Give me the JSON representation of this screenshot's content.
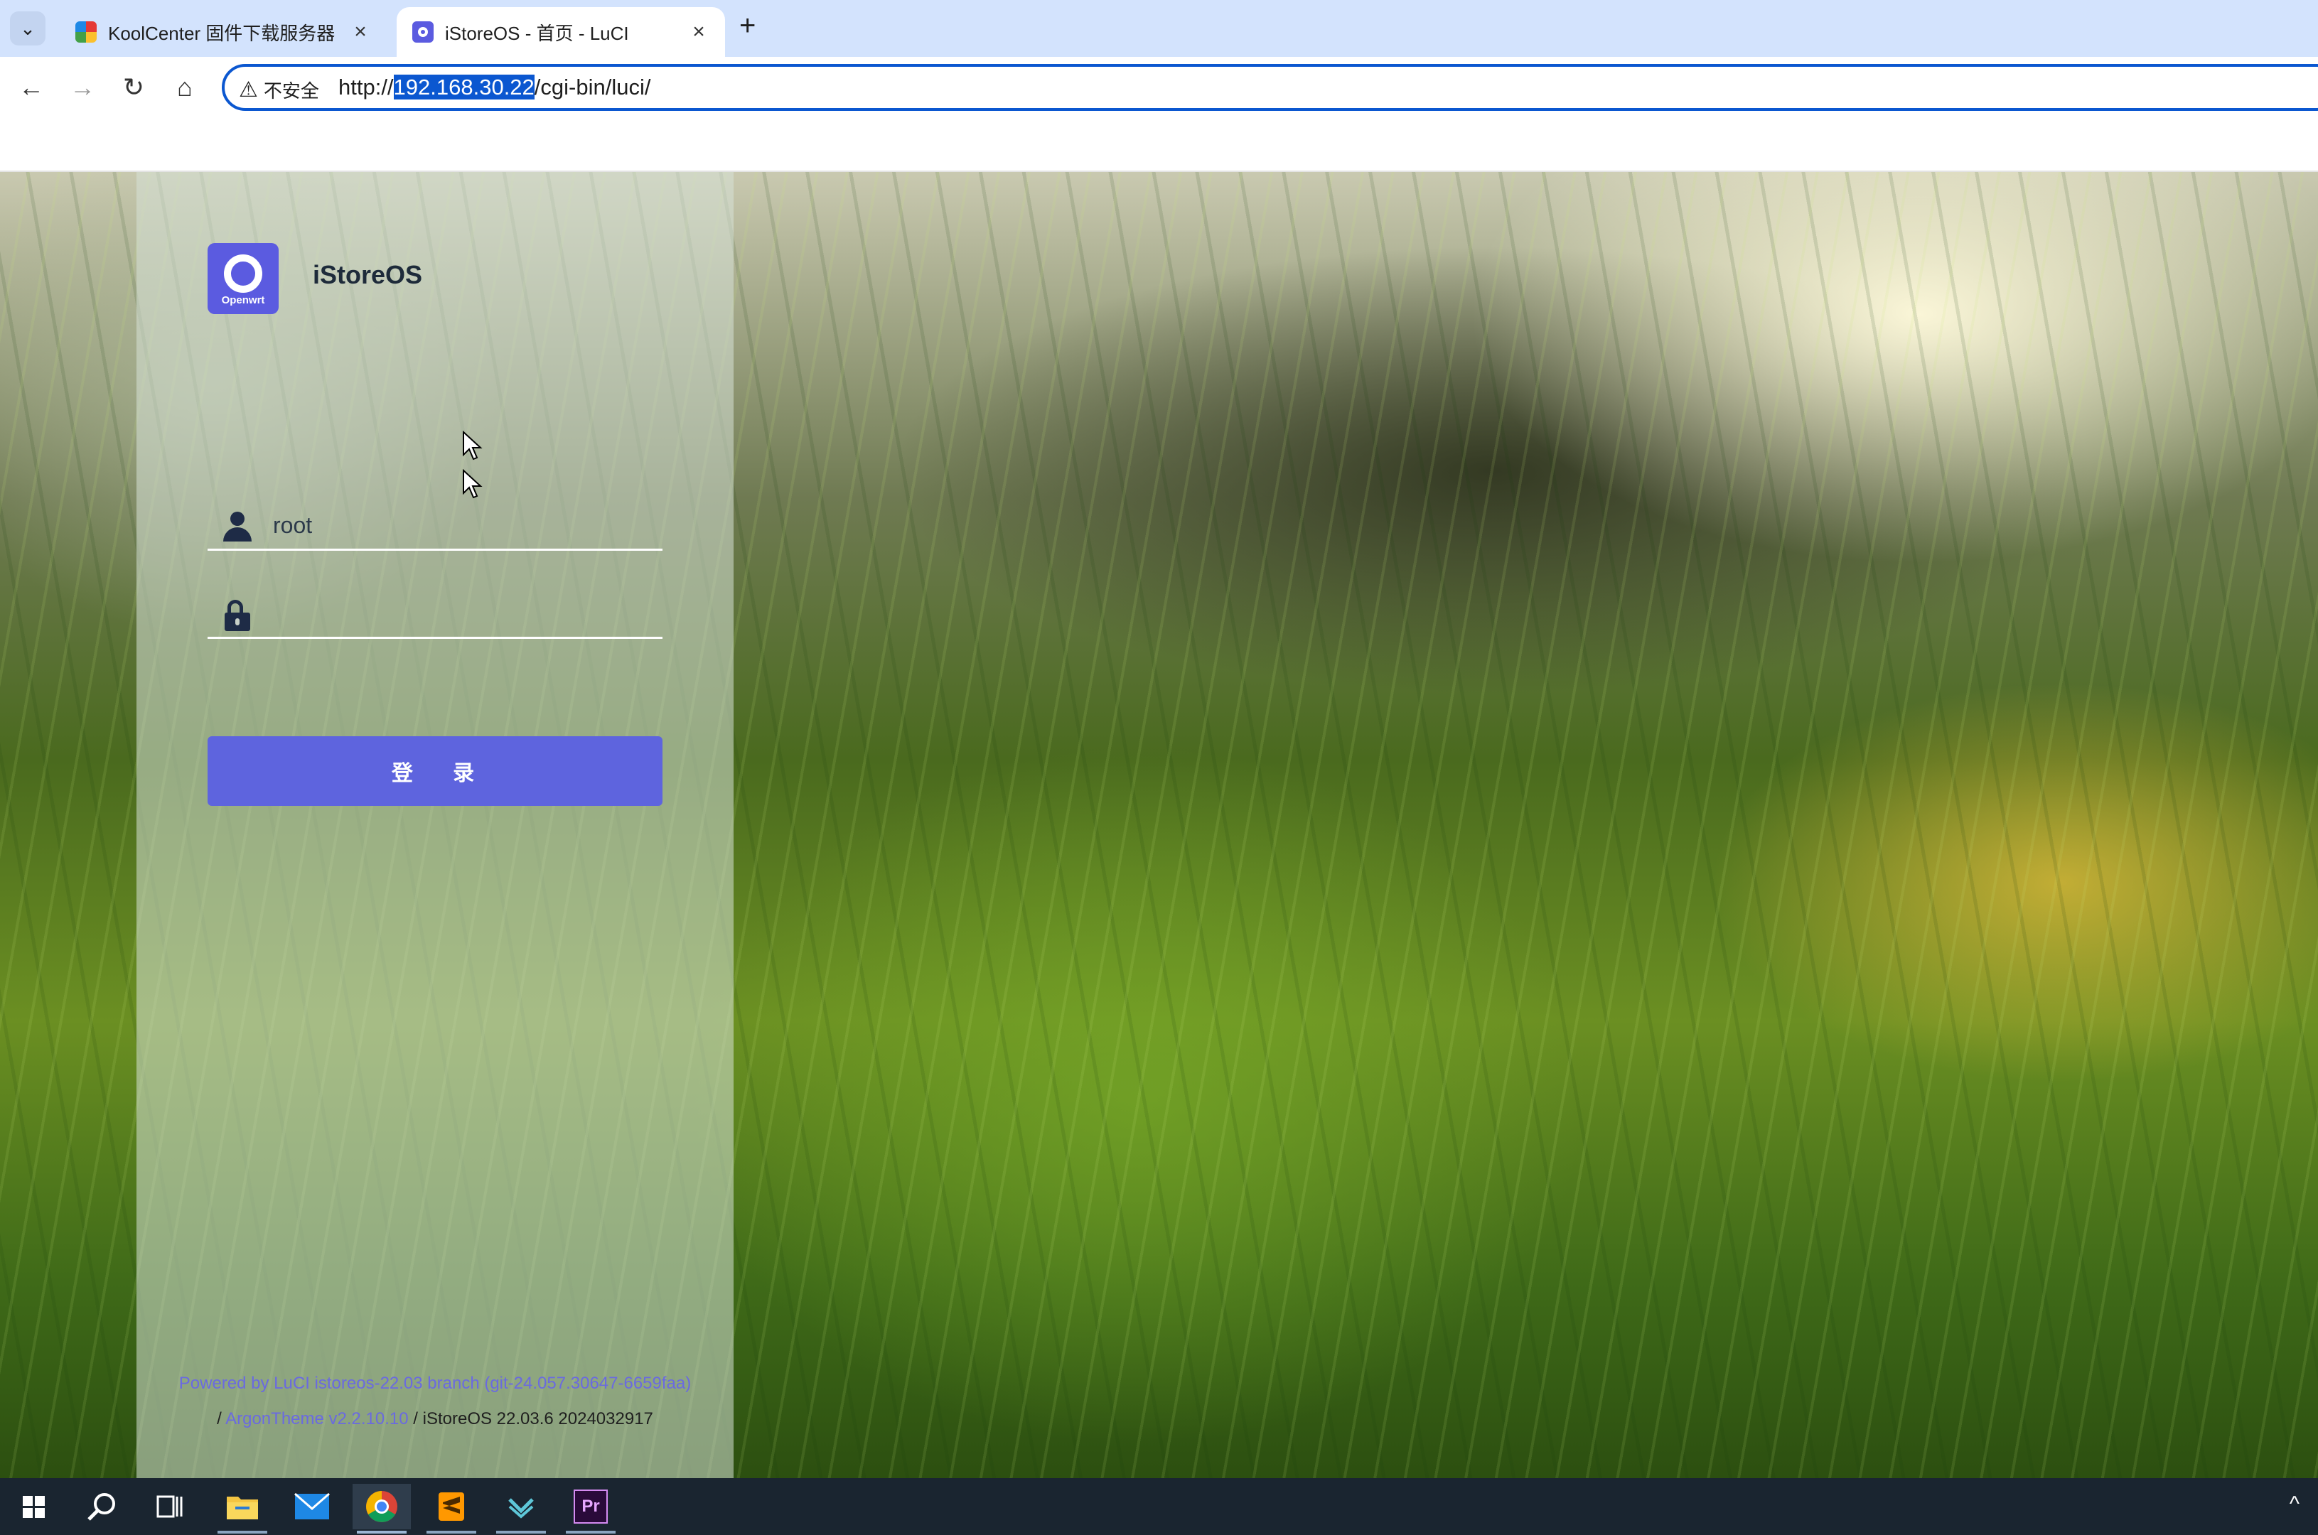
{
  "browser": {
    "tabs": [
      {
        "title": "KoolCenter 固件下载服务器",
        "active": false,
        "favicon": "koolcenter-favicon-icon"
      },
      {
        "title": "iStoreOS - 首页 - LuCI",
        "active": true,
        "favicon": "istoreos-favicon-icon"
      }
    ],
    "new_tab_symbol": "+",
    "security_label": "不安全",
    "url_prefix": "http://",
    "url_host": "192.168.30.22",
    "url_path": "/cgi-bin/luci/"
  },
  "login": {
    "logo_text": "Openwrt",
    "brand": "iStoreOS",
    "username_value": "root",
    "password_value": "",
    "submit_label": "登 录"
  },
  "footer": {
    "powered_link": "Powered by LuCI istoreos-22.03 branch (git-24.057.30647-6659faa)",
    "separator1": "/",
    "theme_link": "ArgonTheme v2.2.10.10",
    "separator2": "/",
    "version": "iStoreOS 22.03.6 2024032917"
  },
  "colors": {
    "accent": "#5e64de",
    "omnibox_border": "#0b57d0",
    "tabstrip": "#d3e3fd",
    "taskbar": "#1a2530"
  },
  "taskbar": {
    "items": [
      "start-icon",
      "search-icon",
      "task-view-icon",
      "file-explorer-icon",
      "mail-icon",
      "chrome-icon",
      "sublime-text-icon",
      "app-icon",
      "premiere-pro-icon"
    ],
    "premiere_label": "Pr"
  }
}
